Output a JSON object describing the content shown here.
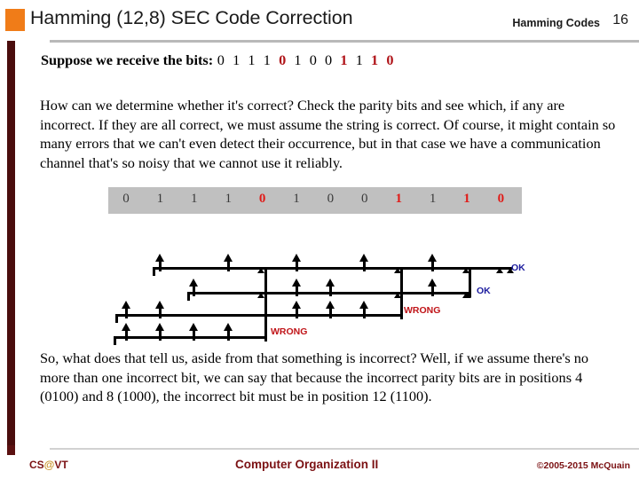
{
  "header": {
    "title": "Hamming (12,8) SEC Code Correction",
    "topic": "Hamming Codes",
    "slide_number": "16",
    "bullet_color": "#f07c18"
  },
  "receive": {
    "label": "Suppose we receive the bits:",
    "bits": [
      "0",
      "1",
      "1",
      "1",
      "0",
      "1",
      "0",
      "0",
      "1",
      "1",
      "1",
      "0"
    ],
    "bad_positions": [
      5,
      9,
      11,
      12
    ],
    "bad_color": "#b01419"
  },
  "paragraphs": {
    "explain": "How can we determine whether it's correct?  Check the parity bits and see which, if any are incorrect.  If they are all correct, we must assume the string is correct.  Of course, it might contain so many errors that we can't even detect their occurrence, but in that case we have a communication channel that's so noisy that we cannot use it reliably.",
    "conclusion": "So, what does that tell us, aside from that something is incorrect?  Well, if we assume there's no more than one incorrect bit, we can say that because the incorrect parity bits are in positions 4 (0100) and 8 (1000), the incorrect bit must be in position 12 (1100)."
  },
  "bitstrip": {
    "bits": [
      "0",
      "1",
      "1",
      "1",
      "0",
      "1",
      "0",
      "0",
      "1",
      "1",
      "1",
      "0"
    ],
    "bad_positions": [
      5,
      9,
      11,
      12
    ],
    "background": "#c0c0c0",
    "bad_color": "#e01b18"
  },
  "parity_checks": [
    {
      "name": "parity-1",
      "verdict": "OK",
      "verdict_color": "#1b1b9e",
      "covered_positions": [
        1,
        3,
        5,
        7,
        9,
        11
      ],
      "tall_arrow_positions": [
        2,
        4,
        6,
        8,
        10
      ],
      "tiny_arrow_positions": [
        5,
        9,
        11,
        12
      ]
    },
    {
      "name": "parity-2",
      "verdict": "OK",
      "verdict_color": "#1b1b9e",
      "covered_positions": [
        2,
        3,
        6,
        7,
        10,
        11
      ],
      "tall_arrow_positions": [
        3,
        6,
        7,
        10
      ],
      "tiny_arrow_positions": [
        5,
        9,
        11
      ]
    },
    {
      "name": "parity-4",
      "verdict": "WRONG",
      "verdict_color": "#c01418",
      "covered_positions": [
        4,
        5,
        6,
        7,
        12
      ],
      "tall_arrow_positions": [
        1,
        2,
        6,
        7,
        8
      ],
      "tiny_arrow_positions": []
    },
    {
      "name": "parity-8",
      "verdict": "WRONG",
      "verdict_color": "#c01418",
      "covered_positions": [
        8,
        9,
        10,
        11,
        12
      ],
      "tall_arrow_positions": [
        1,
        2,
        3,
        4
      ],
      "tiny_arrow_positions": []
    }
  ],
  "footer": {
    "left_prefix": "CS",
    "left_at": "@",
    "left_suffix": "VT",
    "center": "Computer Organization II",
    "right": "©2005-2015 McQuain",
    "color": "#7b1113"
  }
}
